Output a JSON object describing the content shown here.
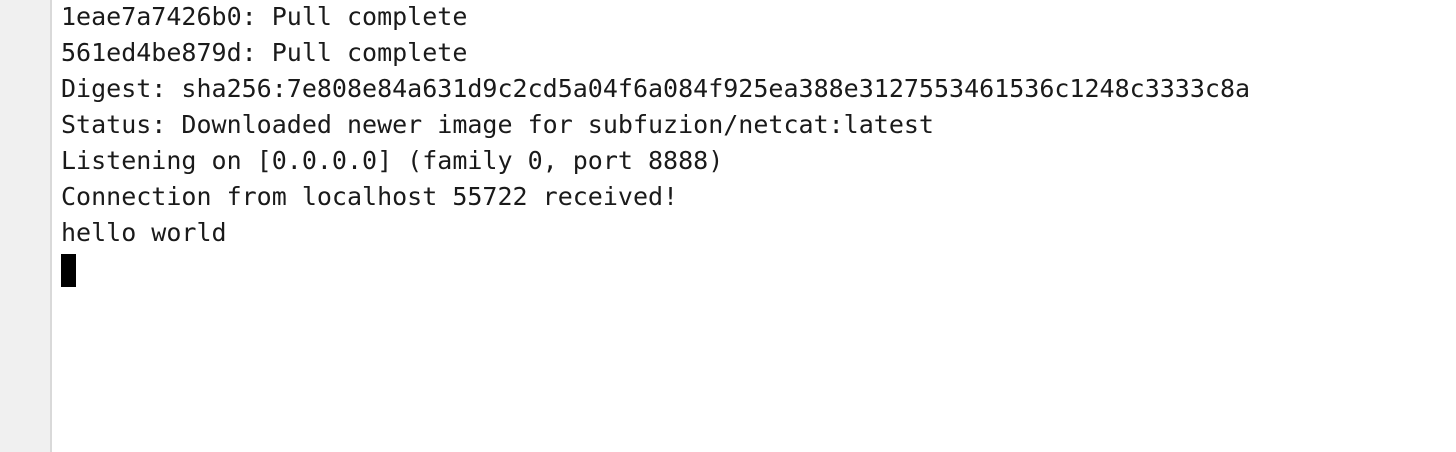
{
  "terminal": {
    "lines": [
      "1eae7a7426b0: Pull complete",
      "561ed4be879d: Pull complete",
      "Digest: sha256:7e808e84a631d9c2cd5a04f6a084f925ea388e3127553461536c1248c3333c8a",
      "Status: Downloaded newer image for subfuzion/netcat:latest",
      "Listening on [0.0.0.0] (family 0, port 8888)",
      "Connection from localhost 55722 received!",
      "hello world"
    ]
  },
  "colors": {
    "background": "#ffffff",
    "gutter": "#f0f0f0",
    "text": "#1a1a1a",
    "cursor": "#000000"
  }
}
